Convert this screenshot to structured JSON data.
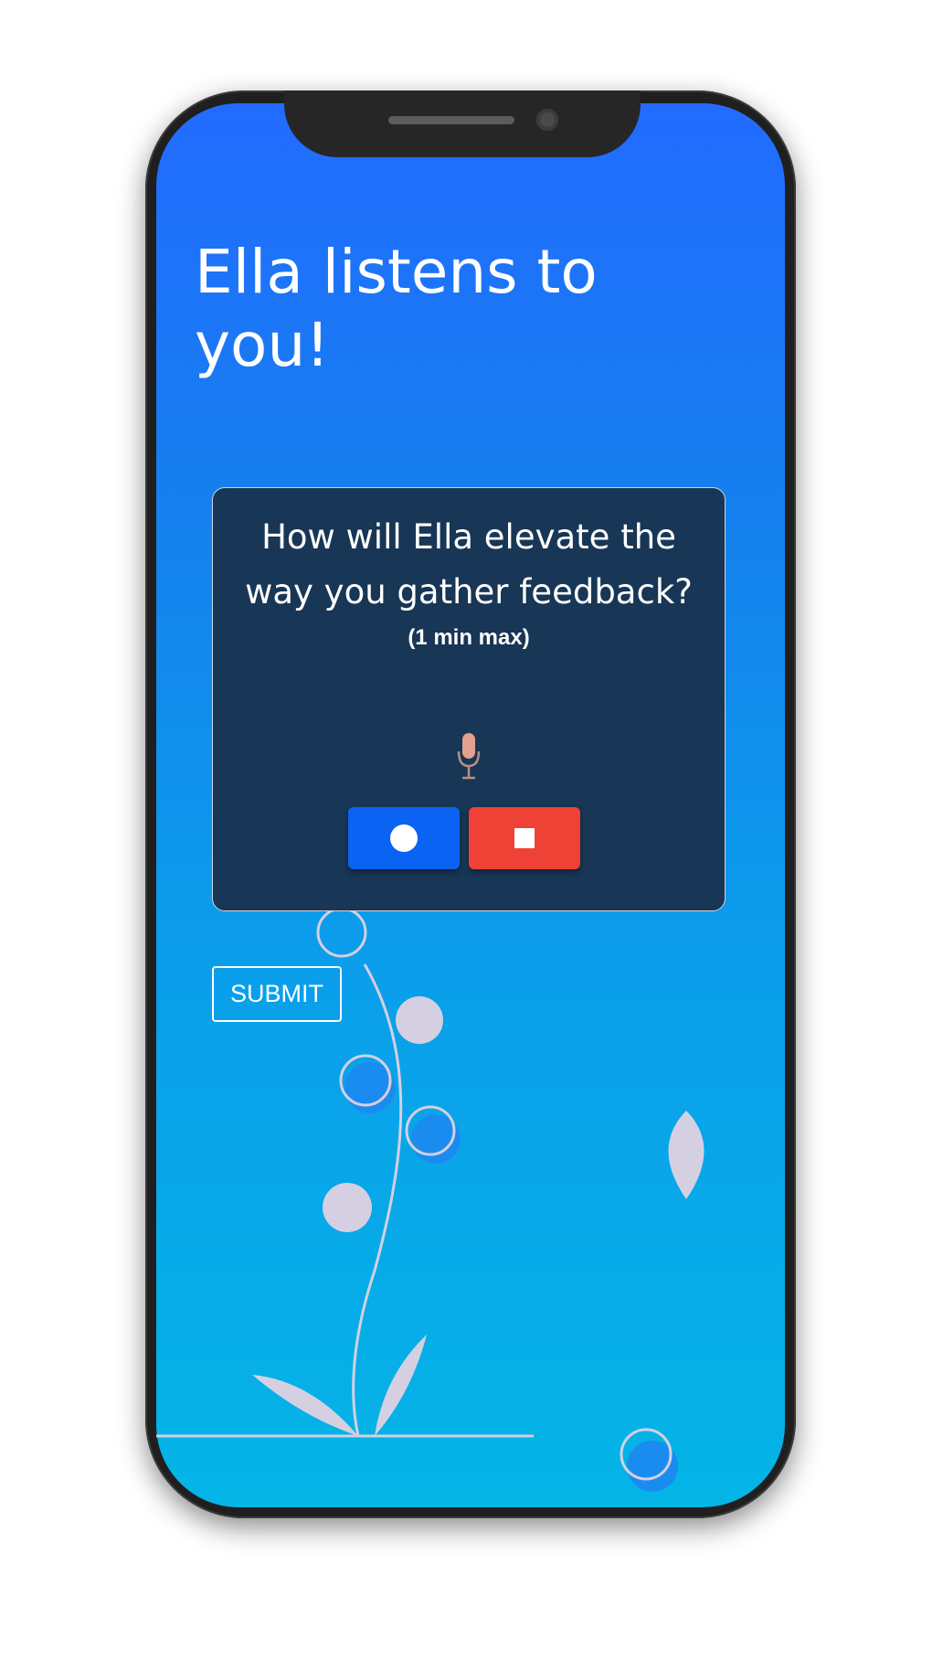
{
  "page": {
    "headline": "Ella listens to you!"
  },
  "prompt_card": {
    "question": "How will Ella elevate the way you gather feedback?",
    "limit_note": "(1 min max)",
    "mic_icon": "microphone-icon",
    "record_icon": "record-dot-icon",
    "stop_icon": "stop-square-icon"
  },
  "submit": {
    "label": "SUBMIT"
  },
  "colors": {
    "screen_top": "#226bff",
    "screen_bottom": "#04b5e6",
    "card_bg": "#183655",
    "record_button": "#0b63f4",
    "stop_button": "#ef4135",
    "decor": "#d4d0e2"
  }
}
